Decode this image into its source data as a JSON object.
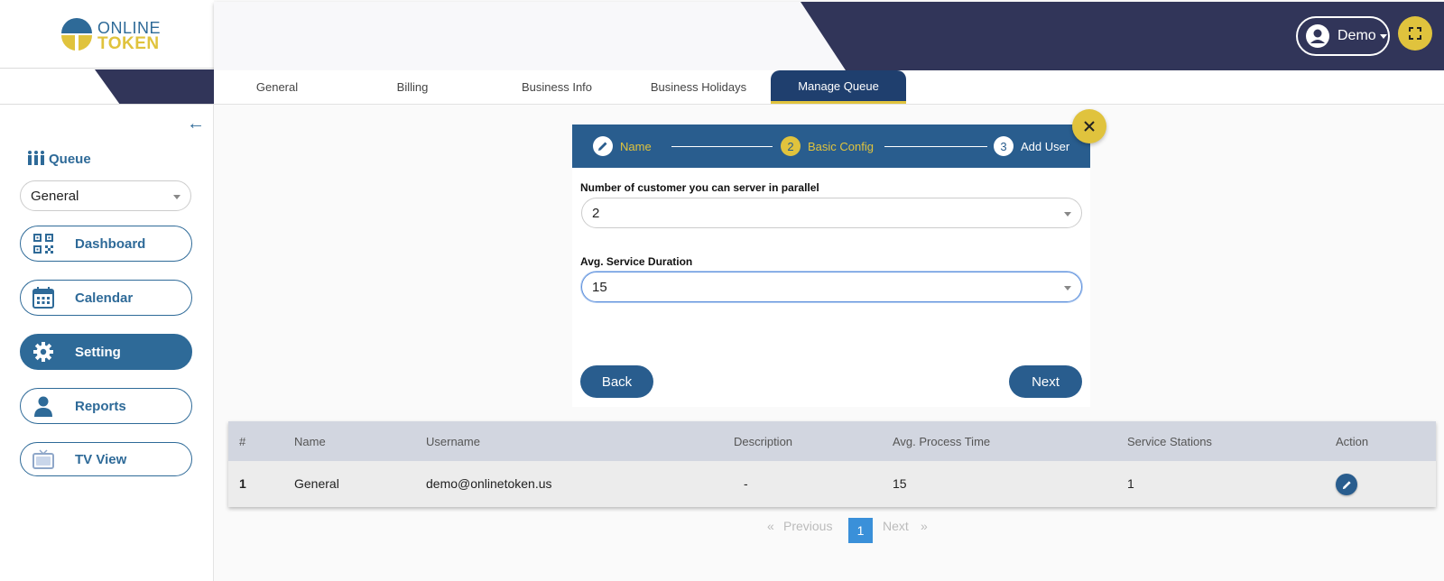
{
  "brand": {
    "line1": "ONLINE",
    "line2": "TOKEN"
  },
  "header": {
    "user_label": "Demo"
  },
  "tabs": [
    {
      "label": "General"
    },
    {
      "label": "Billing"
    },
    {
      "label": "Business Info"
    },
    {
      "label": "Business Holidays"
    },
    {
      "label": "Manage Queue",
      "active": true
    }
  ],
  "sidebar": {
    "queue_label": "Queue",
    "queue_selected": "General",
    "nav": [
      {
        "label": "Dashboard"
      },
      {
        "label": "Calendar"
      },
      {
        "label": "Setting",
        "active": true
      },
      {
        "label": "Reports"
      },
      {
        "label": "TV View"
      }
    ]
  },
  "stepper": {
    "steps": [
      {
        "number": "",
        "label": "Name",
        "state": "done"
      },
      {
        "number": "2",
        "label": "Basic Config",
        "state": "active"
      },
      {
        "number": "3",
        "label": "Add User",
        "state": "pending"
      }
    ]
  },
  "form": {
    "parallel_label": "Number of customer you can server in parallel",
    "parallel_value": "2",
    "duration_label": "Avg. Service Duration",
    "duration_value": "15",
    "back_label": "Back",
    "next_label": "Next"
  },
  "table": {
    "headers": [
      "#",
      "Name",
      "Username",
      "Description",
      "Avg. Process Time",
      "Service Stations",
      "Action"
    ],
    "rows": [
      {
        "num": "1",
        "name": "General",
        "username": "demo@onlinetoken.us",
        "description": "-",
        "avg_time": "15",
        "stations": "1"
      }
    ]
  },
  "pagination": {
    "prev": "Previous",
    "current": "1",
    "next": "Next",
    "first_glyph": "«",
    "last_glyph": "»"
  },
  "colors": {
    "primary": "#295d8e",
    "accent": "#e0c33d",
    "dark": "#313559"
  }
}
